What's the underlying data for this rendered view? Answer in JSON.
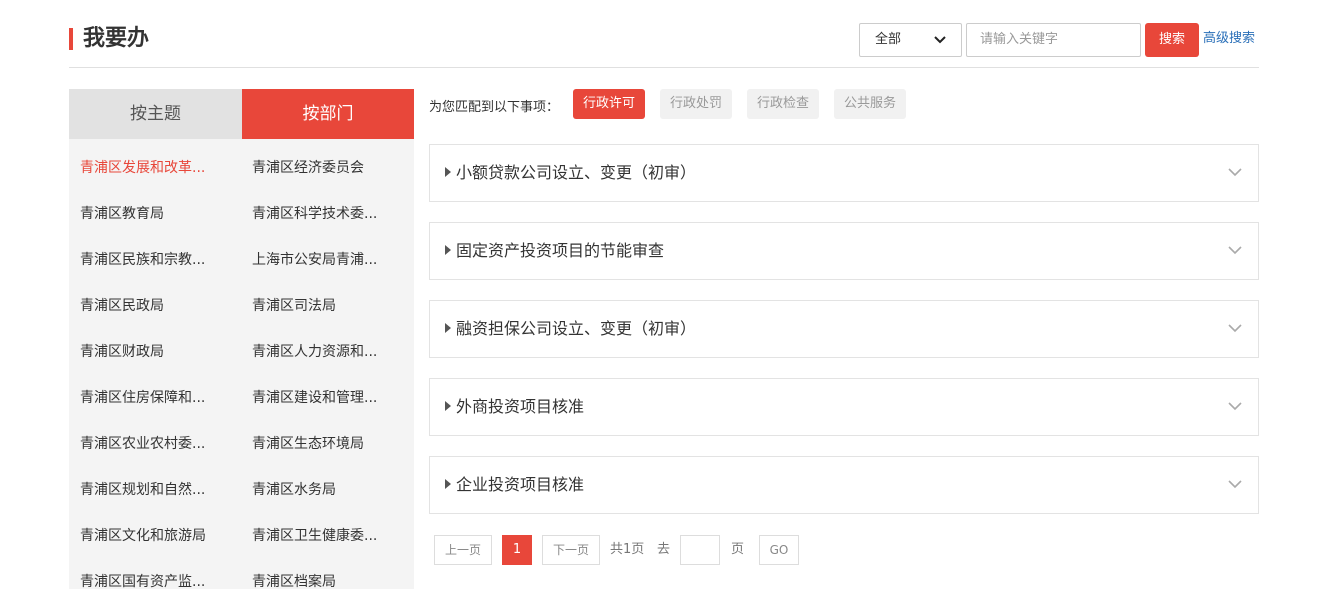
{
  "header": {
    "title": "我要办",
    "scope_select": "全部",
    "search_placeholder": "请输入关键字",
    "search_button": "搜索",
    "advanced_search": "高级搜索"
  },
  "sidebar": {
    "tabs": [
      "按主题",
      "按部门"
    ],
    "active_tab": "按部门",
    "departments": [
      "青浦区发展和改革...",
      "青浦区经济委员会",
      "青浦区教育局",
      "青浦区科学技术委...",
      "青浦区民族和宗教...",
      "上海市公安局青浦...",
      "青浦区民政局",
      "青浦区司法局",
      "青浦区财政局",
      "青浦区人力资源和...",
      "青浦区住房保障和...",
      "青浦区建设和管理...",
      "青浦区农业农村委...",
      "青浦区生态环境局",
      "青浦区规划和自然...",
      "青浦区水务局",
      "青浦区文化和旅游局",
      "青浦区卫生健康委...",
      "青浦区国有资产监...",
      "青浦区档案局"
    ]
  },
  "filter": {
    "label": "为您匹配到以下事项：",
    "chips": [
      "行政许可",
      "行政处罚",
      "行政检查",
      "公共服务"
    ],
    "active_chip": "行政许可"
  },
  "items": [
    "小额贷款公司设立、变更（初审）",
    "固定资产投资项目的节能审查",
    "融资担保公司设立、变更（初审）",
    "外商投资项目核准",
    "企业投资项目核准"
  ],
  "pagination": {
    "prev": "上一页",
    "current_page": "1",
    "next": "下一页",
    "total_text": "共1页",
    "goto_label": "去",
    "page_unit": "页",
    "go_button": "GO"
  },
  "colors": {
    "accent": "#e8473a",
    "link": "#2a6fb8"
  }
}
